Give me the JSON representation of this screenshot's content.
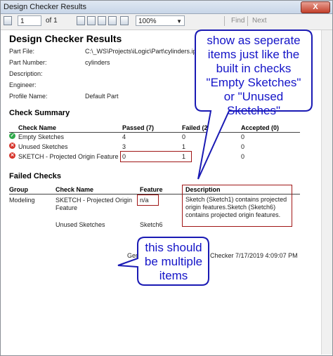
{
  "window": {
    "title": "Design Checker Results",
    "close_label": "X"
  },
  "toolbar": {
    "page_current": "1",
    "page_of": "of 1",
    "zoom": "100%",
    "find_label": "Find",
    "next_label": "Next"
  },
  "report": {
    "title": "Design Checker Results",
    "fields": [
      {
        "label": "Part File:",
        "value": "C:\\_WS\\Projects\\iLogic\\Part\\cylinders.ipt"
      },
      {
        "label": "Part Number:",
        "value": "cylinders"
      },
      {
        "label": "Description:",
        "value": ""
      },
      {
        "label": "Engineer:",
        "value": ""
      },
      {
        "label": "Profile Name:",
        "value": "Default Part"
      }
    ],
    "summary": {
      "heading": "Check Summary",
      "columns": [
        "Check Name",
        "Passed (7)",
        "Failed (2)",
        "Accepted (0)"
      ],
      "rows": [
        {
          "status": "pass",
          "name": "Empty Sketches",
          "passed": "4",
          "failed": "0",
          "accepted": "0"
        },
        {
          "status": "fail",
          "name": "Unused Sketches",
          "passed": "3",
          "failed": "1",
          "accepted": "0"
        },
        {
          "status": "fail",
          "name": "SKETCH - Projected Origin Feature",
          "passed": "0",
          "failed": "1",
          "accepted": "0"
        }
      ]
    },
    "failed": {
      "heading": "Failed Checks",
      "columns": [
        "Group",
        "Check Name",
        "Feature",
        "Description"
      ],
      "rows": [
        {
          "group": "Modeling",
          "check_line1": "SKETCH - Projected Origin",
          "check_line2": "Feature",
          "feature": "n/a",
          "description": "Sketch (Sketch1) contains projected origin features.Sketch (Sketch6) contains projected origin features."
        },
        {
          "group": "",
          "check_line1": "Unused Sketches",
          "check_line2": "",
          "feature": "Sketch6",
          "description": ""
        }
      ]
    },
    "footer": {
      "left": "Gen",
      "right": "Checker  7/17/2019 4:09:07 PM"
    }
  },
  "annotations": {
    "callout_top": [
      "show as seperate",
      "items just like the",
      "built in checks",
      "\"Empty Sketches\"",
      "or \"Unused",
      "Sketches\""
    ],
    "callout_bottom": [
      "this should",
      "be multiple",
      "items"
    ]
  },
  "colors": {
    "callout_border": "#1a1ab4",
    "callout_text": "#1414c8",
    "highlight_box": "#a01616"
  }
}
